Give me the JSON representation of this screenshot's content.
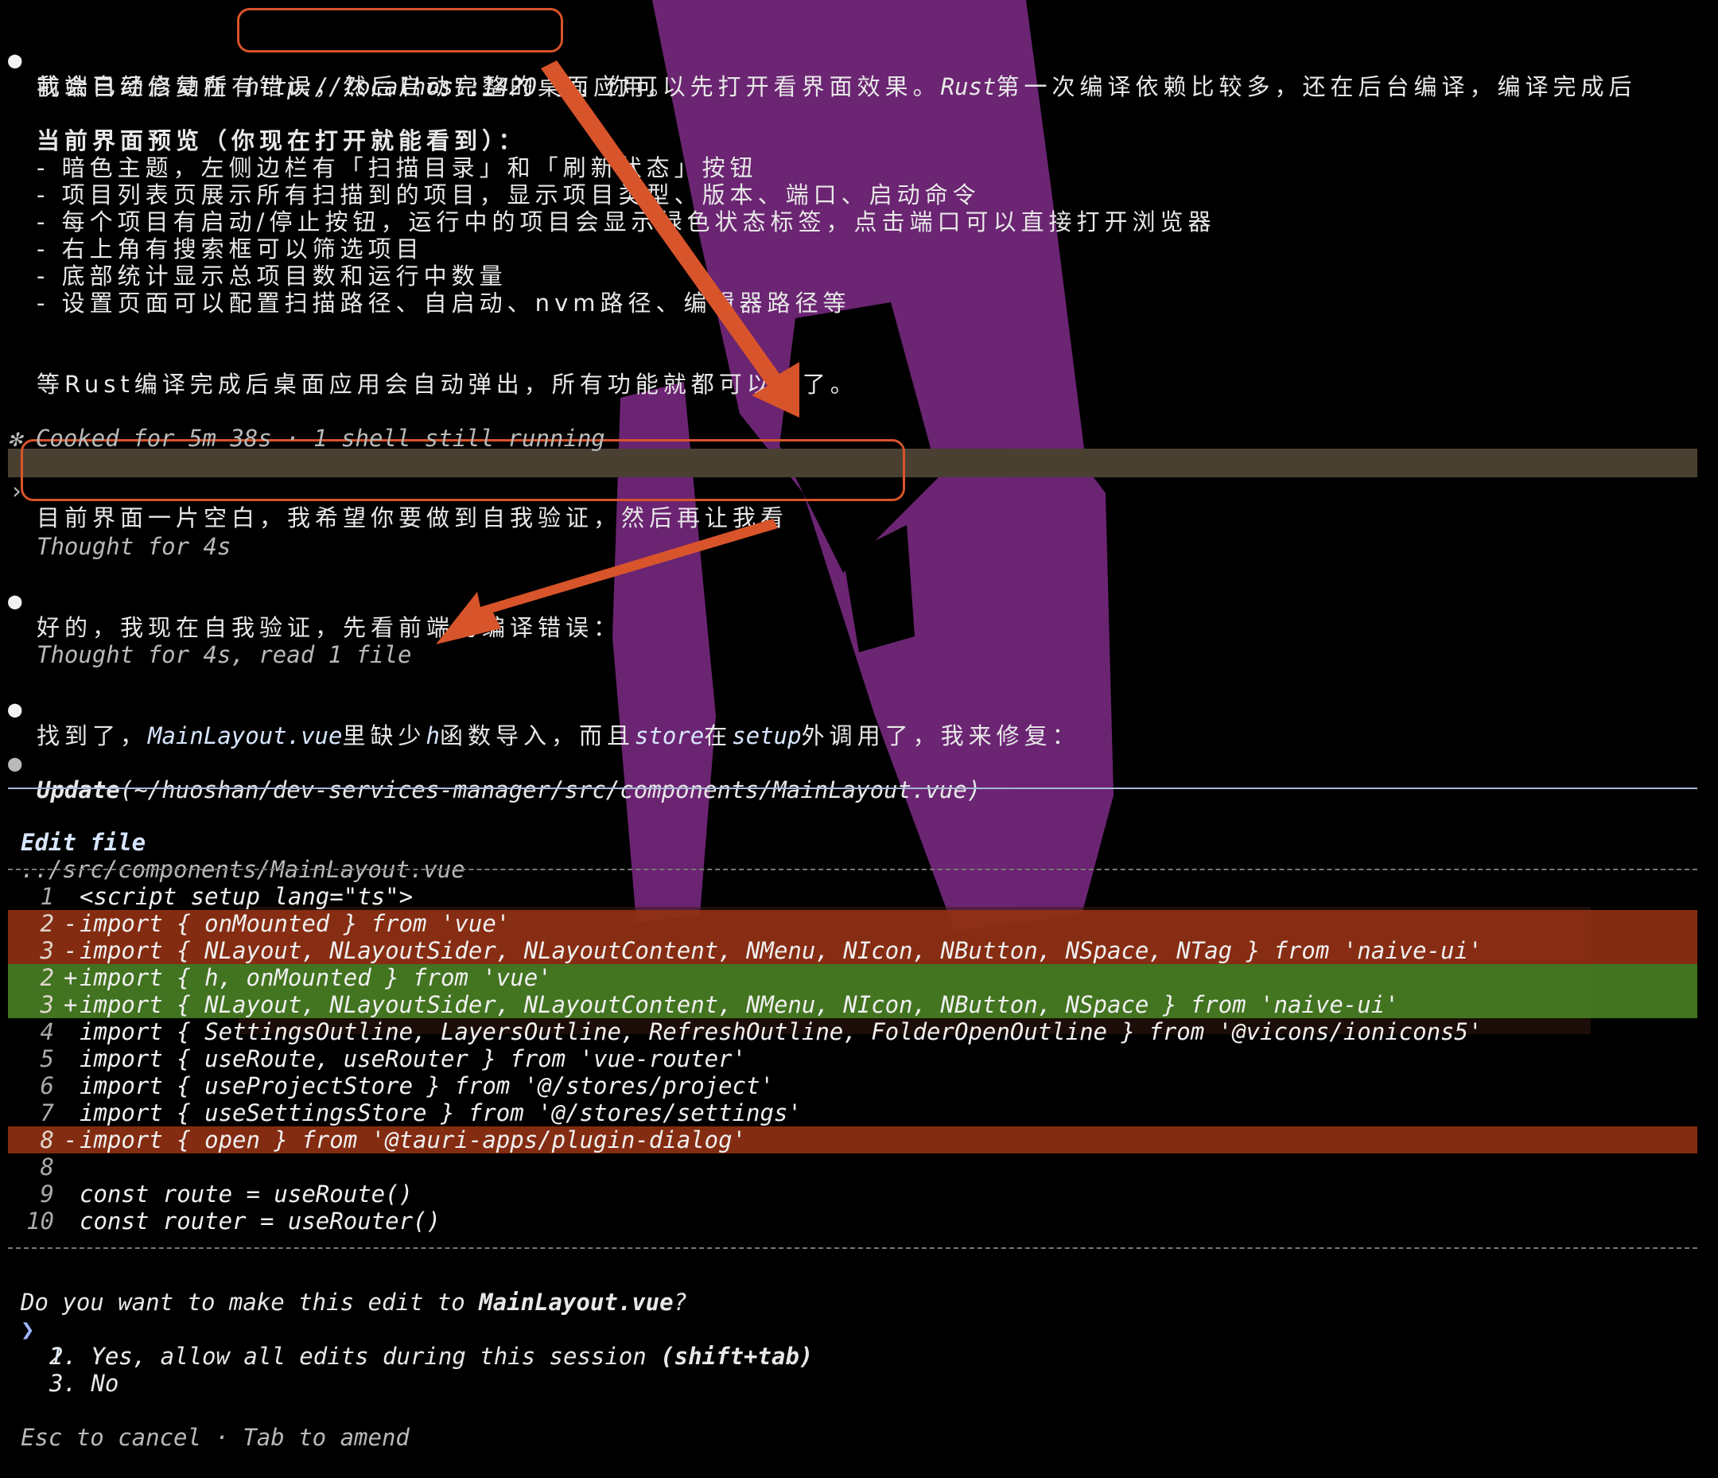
{
  "colors": {
    "background": "#000000",
    "accent_arrow": "#d8542a",
    "diff_removed": "#963214",
    "diff_added": "#467d23",
    "user_message_bg": "#4a4032"
  },
  "messages": {
    "intro": {
      "prefix": "前端已经启动在",
      "url": "http://localhost:1420",
      "rest1": "了，你可以先打开看界面效果。",
      "rust": "Rust",
      "rest2": "第一次编译依赖比较多，还在后台编译，编译完成后",
      "line2": "我会自动修复所有错误，然后启动完整的桌面应用。"
    },
    "preview_heading": "当前界面预览（你现在打开就能看到）：",
    "preview_items": [
      "- 暗色主题，左侧边栏有「扫描目录」和「刷新状态」按钮",
      "- 项目列表页展示所有扫描到的项目，显示项目类型、版本、端口、启动命令",
      "- 每个项目有启动/停止按钮，运行中的项目会显示绿色状态标签，点击端口可以直接打开浏览器",
      "- 右上角有搜索框可以筛选项目",
      "- 底部统计显示总项目数和运行中数量",
      "- 设置页面可以配置扫描路径、自启动、nvm路径、编辑器路径等"
    ],
    "closing": "等Rust编译完成后桌面应用会自动弹出，所有功能就都可以用了。",
    "status": "✻ Cooked for 5m 38s · 1 shell still running",
    "user_message": "目前界面一片空白，我希望你要做到自我验证，然后再让我看",
    "thought1": "Thought for 4s",
    "reply1": "好的，我现在自我验证，先看前端的编译错误：",
    "thought2": "Thought for 4s, read 1 file",
    "reply2": {
      "p1": "找到了，",
      "file": "MainLayout.vue",
      "p2": "里缺少",
      "h": "h",
      "p3": "函数导入，而且",
      "store": "store",
      "p4": "在",
      "setup": "setup",
      "p5": "外调用了，我来修复："
    },
    "update": {
      "label": "Update",
      "path": "(~/huoshan/dev-services-manager/src/components/MainLayout.vue)"
    }
  },
  "edit": {
    "title": "Edit file",
    "path": "../src/components/MainLayout.vue",
    "lines": [
      {
        "num": "1",
        "sign": " ",
        "code": "<script setup lang=\"ts\">",
        "kind": "ctx"
      },
      {
        "num": "2",
        "sign": "-",
        "code": "import { onMounted } from 'vue'",
        "kind": "del"
      },
      {
        "num": "3",
        "sign": "-",
        "code": "import { NLayout, NLayoutSider, NLayoutContent, NMenu, NIcon, NButton, NSpace, NTag } from 'naive-ui'",
        "kind": "del"
      },
      {
        "num": "2",
        "sign": "+",
        "code": "import { h, onMounted } from 'vue'",
        "kind": "add"
      },
      {
        "num": "3",
        "sign": "+",
        "code": "import { NLayout, NLayoutSider, NLayoutContent, NMenu, NIcon, NButton, NSpace } from 'naive-ui'",
        "kind": "add"
      },
      {
        "num": "4",
        "sign": " ",
        "code": "import { SettingsOutline, LayersOutline, RefreshOutline, FolderOpenOutline } from '@vicons/ionicons5'",
        "kind": "ctx"
      },
      {
        "num": "5",
        "sign": " ",
        "code": "import { useRoute, useRouter } from 'vue-router'",
        "kind": "ctx"
      },
      {
        "num": "6",
        "sign": " ",
        "code": "import { useProjectStore } from '@/stores/project'",
        "kind": "ctx"
      },
      {
        "num": "7",
        "sign": " ",
        "code": "import { useSettingsStore } from '@/stores/settings'",
        "kind": "ctx"
      },
      {
        "num": "8",
        "sign": "-",
        "code": "import { open } from '@tauri-apps/plugin-dialog'",
        "kind": "del"
      },
      {
        "num": "8",
        "sign": " ",
        "code": "",
        "kind": "ctx"
      },
      {
        "num": "9",
        "sign": " ",
        "code": "const route = useRoute()",
        "kind": "ctx"
      },
      {
        "num": "10",
        "sign": " ",
        "code": "const router = useRouter()",
        "kind": "ctx"
      }
    ]
  },
  "prompt": {
    "question_prefix": "Do you want to make this edit to ",
    "question_file": "MainLayout.vue",
    "question_suffix": "?",
    "caret": "❯",
    "options": [
      {
        "label": "1. Yes"
      },
      {
        "label": "2. Yes, allow all edits during this session ",
        "hint": "(shift+tab)"
      },
      {
        "label": "3. No"
      }
    ],
    "footer": "Esc to cancel · Tab to amend"
  }
}
